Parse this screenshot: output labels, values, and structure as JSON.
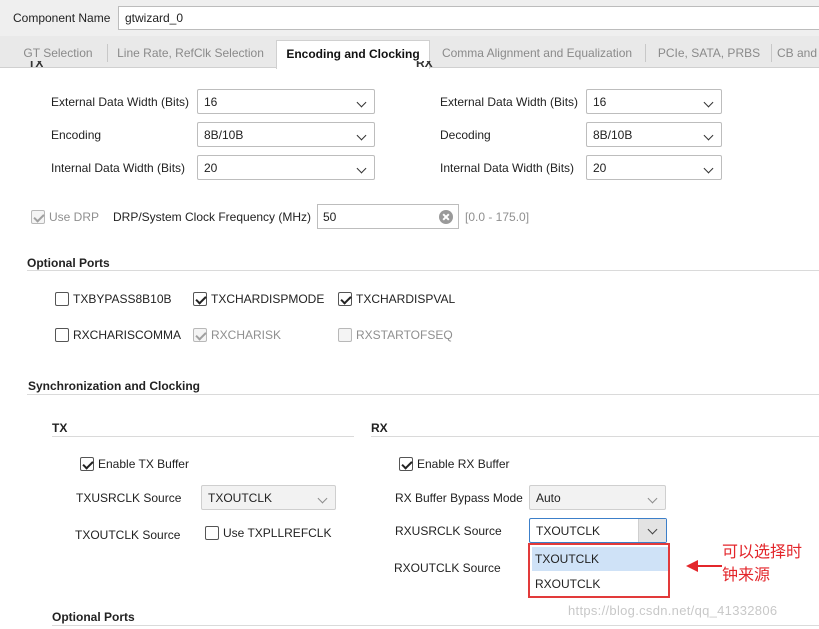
{
  "header": {
    "component_name_label": "Component Name",
    "component_name_value": "gtwizard_0"
  },
  "tabs": [
    {
      "label": "GT Selection"
    },
    {
      "label": "Line Rate, RefClk Selection"
    },
    {
      "label": "Encoding and Clocking"
    },
    {
      "label": "Comma Alignment and Equalization"
    },
    {
      "label": "PCIe, SATA, PRBS"
    },
    {
      "label": "CB and"
    }
  ],
  "encoding": {
    "tx_header": "TX",
    "rx_header": "RX",
    "tx": {
      "ext_width_label": "External Data Width (Bits)",
      "ext_width_value": "16",
      "encoding_label": "Encoding",
      "encoding_value": "8B/10B",
      "int_width_label": "Internal Data Width (Bits)",
      "int_width_value": "20"
    },
    "rx": {
      "ext_width_label": "External Data Width (Bits)",
      "ext_width_value": "16",
      "decoding_label": "Decoding",
      "decoding_value": "8B/10B",
      "int_width_label": "Internal Data Width (Bits)",
      "int_width_value": "20"
    }
  },
  "drp": {
    "use_drp_label": "Use DRP",
    "freq_label": "DRP/System Clock Frequency (MHz)",
    "freq_value": "50",
    "freq_range": "[0.0 - 175.0]"
  },
  "optional_ports": {
    "title": "Optional Ports",
    "items": [
      {
        "label": "TXBYPASS8B10B"
      },
      {
        "label": "TXCHARDISPMODE"
      },
      {
        "label": "TXCHARDISPVAL"
      },
      {
        "label": "RXCHARISCOMMA"
      },
      {
        "label": "RXCHARISK"
      },
      {
        "label": "RXSTARTOFSEQ"
      }
    ]
  },
  "sync": {
    "title": "Synchronization and Clocking",
    "tx": {
      "title": "TX",
      "enable_buffer_label": "Enable TX Buffer",
      "usrclk_label": "TXUSRCLK Source",
      "usrclk_value": "TXOUTCLK",
      "outclk_label": "TXOUTCLK Source",
      "use_pllrefclk_label": "Use TXPLLREFCLK"
    },
    "rx": {
      "title": "RX",
      "enable_buffer_label": "Enable RX Buffer",
      "bypass_label": "RX Buffer Bypass Mode",
      "bypass_value": "Auto",
      "usrclk_label": "RXUSRCLK Source",
      "usrclk_value": "TXOUTCLK",
      "outclk_label": "RXOUTCLK Source",
      "dropdown_options": [
        "TXOUTCLK",
        "RXOUTCLK"
      ]
    }
  },
  "optional_ports_2": {
    "title": "Optional Ports"
  },
  "annotation": {
    "line1": "可以选择时",
    "line2": "钟来源"
  },
  "watermark": "https://blog.csdn.net/qq_41332806",
  "colors": {
    "annotation_red": "#e3262b",
    "selected_option": "#cfe2f7",
    "focus_blue": "#3c7fc9"
  }
}
